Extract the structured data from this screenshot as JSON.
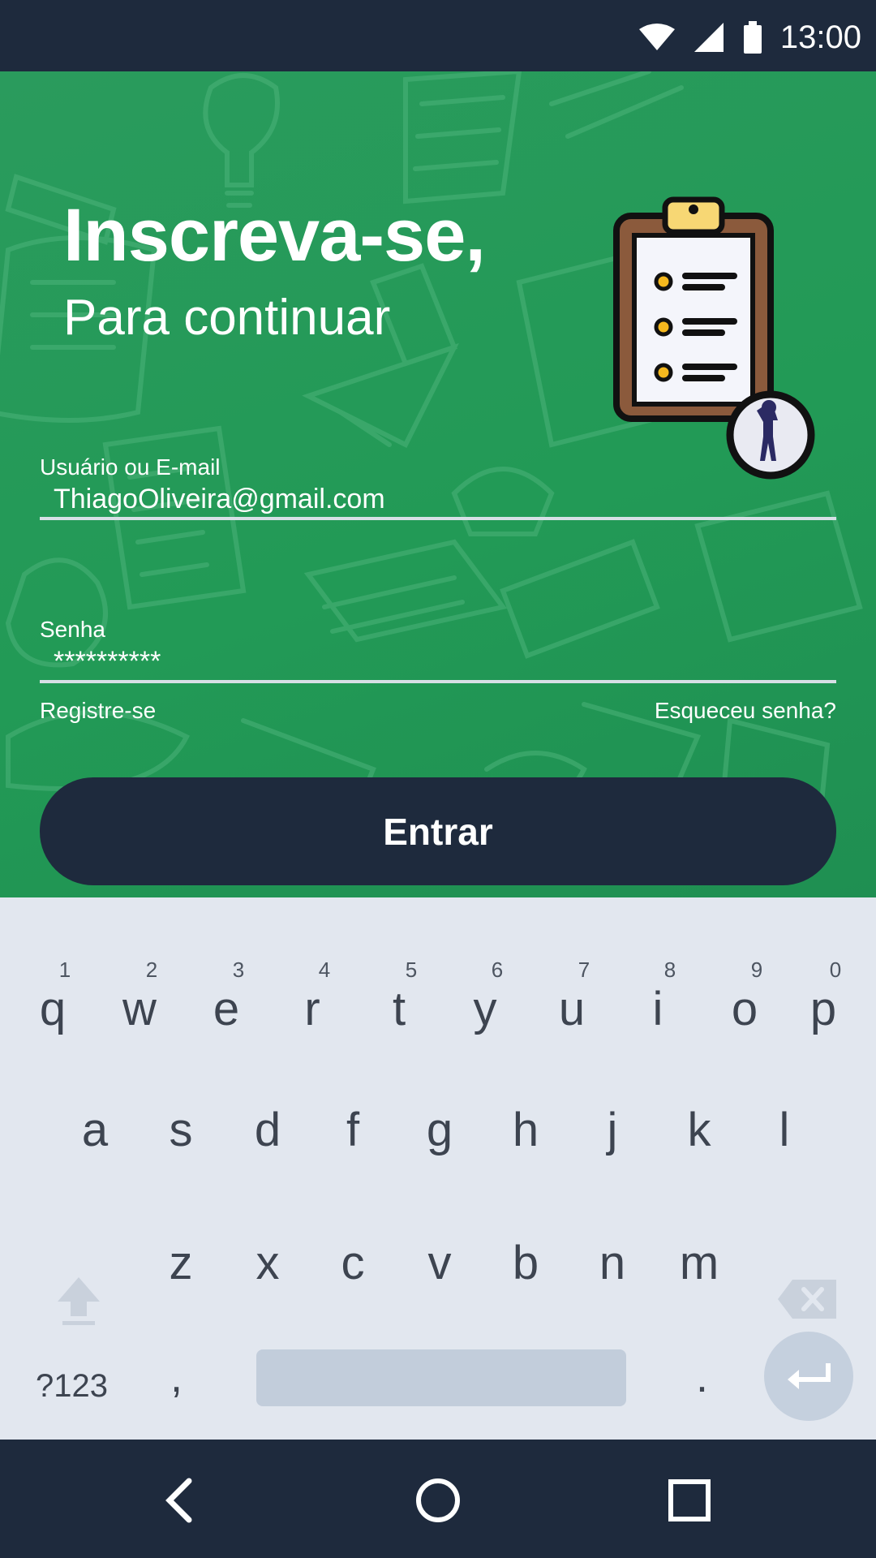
{
  "status_bar": {
    "time": "13:00"
  },
  "header": {
    "title": "Inscreva-se,",
    "subtitle": "Para continuar"
  },
  "form": {
    "username": {
      "label": "Usuário ou E-mail",
      "value": "ThiagoOliveira@gmail.com"
    },
    "password": {
      "label": "Senha",
      "value": "**********"
    },
    "register_link": "Registre-se",
    "forgot_link": "Esqueceu senha?",
    "submit_label": "Entrar"
  },
  "keyboard": {
    "row1": [
      {
        "ch": "q",
        "num": "1"
      },
      {
        "ch": "w",
        "num": "2"
      },
      {
        "ch": "e",
        "num": "3"
      },
      {
        "ch": "r",
        "num": "4"
      },
      {
        "ch": "t",
        "num": "5"
      },
      {
        "ch": "y",
        "num": "6"
      },
      {
        "ch": "u",
        "num": "7"
      },
      {
        "ch": "i",
        "num": "8"
      },
      {
        "ch": "o",
        "num": "9"
      },
      {
        "ch": "p",
        "num": "0"
      }
    ],
    "row2": [
      "a",
      "s",
      "d",
      "f",
      "g",
      "h",
      "j",
      "k",
      "l"
    ],
    "row3": [
      "z",
      "x",
      "c",
      "v",
      "b",
      "n",
      "m"
    ],
    "symbols_label": "?123",
    "comma": ",",
    "period": "."
  },
  "colors": {
    "accent_green": "#229a56",
    "dark_navy": "#1e2a3d",
    "keyboard_bg": "#e2e7ef"
  }
}
